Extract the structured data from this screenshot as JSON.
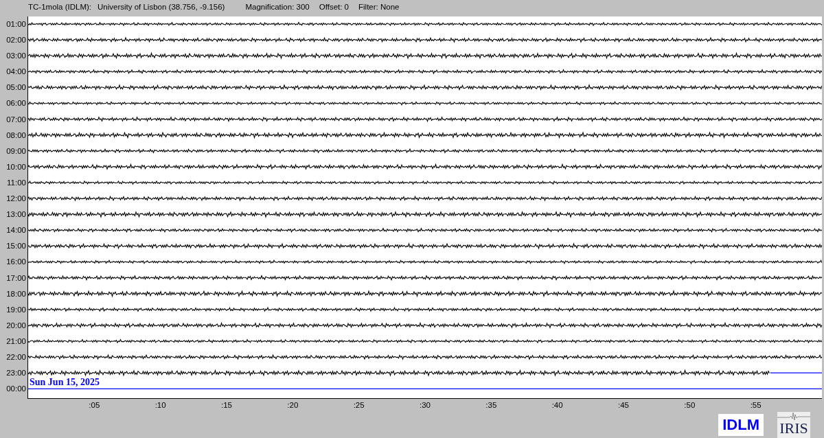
{
  "header": {
    "station": "TC-1mola (IDLM):",
    "location": "University of Lisbon (38.756, -9.156)",
    "magnification": "Magnification: 300",
    "offset": "Offset: 0",
    "filter": "Filter: None"
  },
  "rows": [
    {
      "time": "01:00",
      "kind": "full"
    },
    {
      "time": "02:00",
      "kind": "full"
    },
    {
      "time": "03:00",
      "kind": "full"
    },
    {
      "time": "04:00",
      "kind": "full"
    },
    {
      "time": "05:00",
      "kind": "full"
    },
    {
      "time": "06:00",
      "kind": "full"
    },
    {
      "time": "07:00",
      "kind": "full"
    },
    {
      "time": "08:00",
      "kind": "full"
    },
    {
      "time": "09:00",
      "kind": "full"
    },
    {
      "time": "10:00",
      "kind": "full"
    },
    {
      "time": "11:00",
      "kind": "full"
    },
    {
      "time": "12:00",
      "kind": "full"
    },
    {
      "time": "13:00",
      "kind": "full"
    },
    {
      "time": "14:00",
      "kind": "full"
    },
    {
      "time": "15:00",
      "kind": "full"
    },
    {
      "time": "16:00",
      "kind": "full"
    },
    {
      "time": "17:00",
      "kind": "full"
    },
    {
      "time": "18:00",
      "kind": "full"
    },
    {
      "time": "19:00",
      "kind": "full"
    },
    {
      "time": "20:00",
      "kind": "full"
    },
    {
      "time": "21:00",
      "kind": "full"
    },
    {
      "time": "22:00",
      "kind": "full"
    },
    {
      "time": "23:00",
      "kind": "partial"
    },
    {
      "time": "00:00",
      "kind": "empty"
    }
  ],
  "date_label": "Sun Jun 15, 2025",
  "x_ticks": [
    ":05",
    ":10",
    ":15",
    ":20",
    ":25",
    ":30",
    ":35",
    ":40",
    ":45",
    ":50",
    ":55"
  ],
  "logos": {
    "network": "IDLM",
    "organization": "IRIS"
  }
}
